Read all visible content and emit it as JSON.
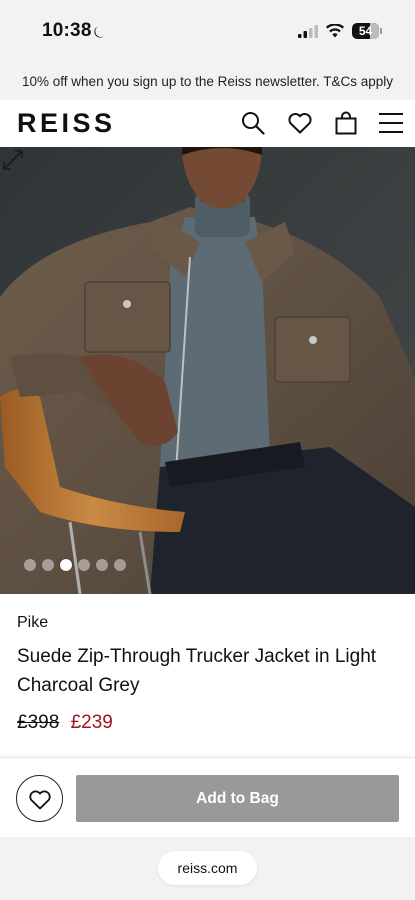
{
  "status_bar": {
    "time": "10:38",
    "battery": "54",
    "moon_icon": "moon-icon",
    "signal_icon": "cellular-signal-icon",
    "wifi_icon": "wifi-icon"
  },
  "promo": {
    "text": "10% off when you sign up to the Reiss newsletter. T&Cs apply"
  },
  "header": {
    "logo": "REISS",
    "icons": [
      "search-icon",
      "heart-icon",
      "bag-icon",
      "menu-icon"
    ]
  },
  "gallery": {
    "dot_count": 6,
    "active_index": 2,
    "expand_icon": "expand-icon"
  },
  "product": {
    "brand": "Pike",
    "title": "Suede Zip-Through Trucker Jacket in Light Charcoal Grey",
    "price_old": "£398",
    "price_new": "£239"
  },
  "actions": {
    "add_to_bag": "Add to Bag",
    "wishlist_icon": "heart-icon"
  },
  "browser": {
    "url": "reiss.com"
  },
  "colors": {
    "sale_price": "#a3121e",
    "add_to_bag_bg": "#999999",
    "chrome_bg": "#f2f2f2"
  }
}
